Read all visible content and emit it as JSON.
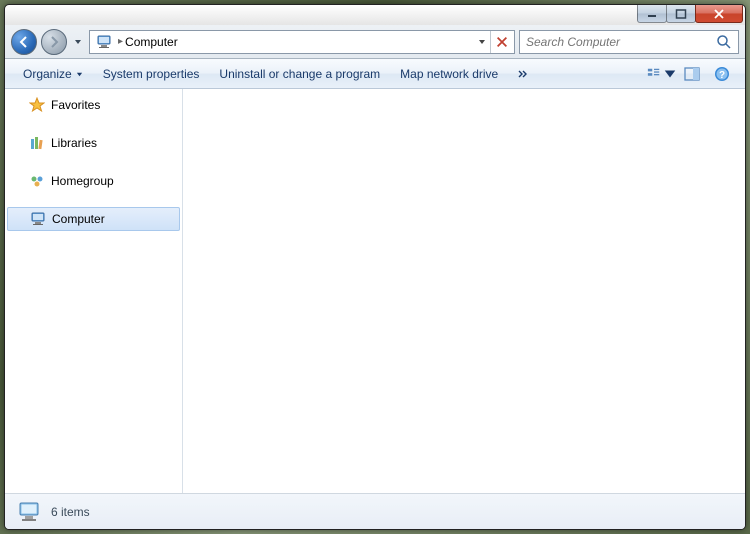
{
  "titlebar": {
    "minimize": "Minimize",
    "maximize": "Maximize",
    "close": "Close"
  },
  "address": {
    "location": "Computer",
    "refresh_label": "Refresh"
  },
  "search": {
    "placeholder": "Search Computer"
  },
  "toolbar": {
    "organize": "Organize",
    "system_properties": "System properties",
    "uninstall": "Uninstall or change a program",
    "map_drive": "Map network drive",
    "views_label": "Change your view",
    "preview_label": "Show the preview pane",
    "help_label": "Get help"
  },
  "sidebar": {
    "items": [
      {
        "label": "Favorites",
        "icon": "star"
      },
      {
        "label": "Libraries",
        "icon": "libraries"
      },
      {
        "label": "Homegroup",
        "icon": "homegroup"
      },
      {
        "label": "Computer",
        "icon": "computer"
      }
    ]
  },
  "status": {
    "text": "6 items"
  }
}
